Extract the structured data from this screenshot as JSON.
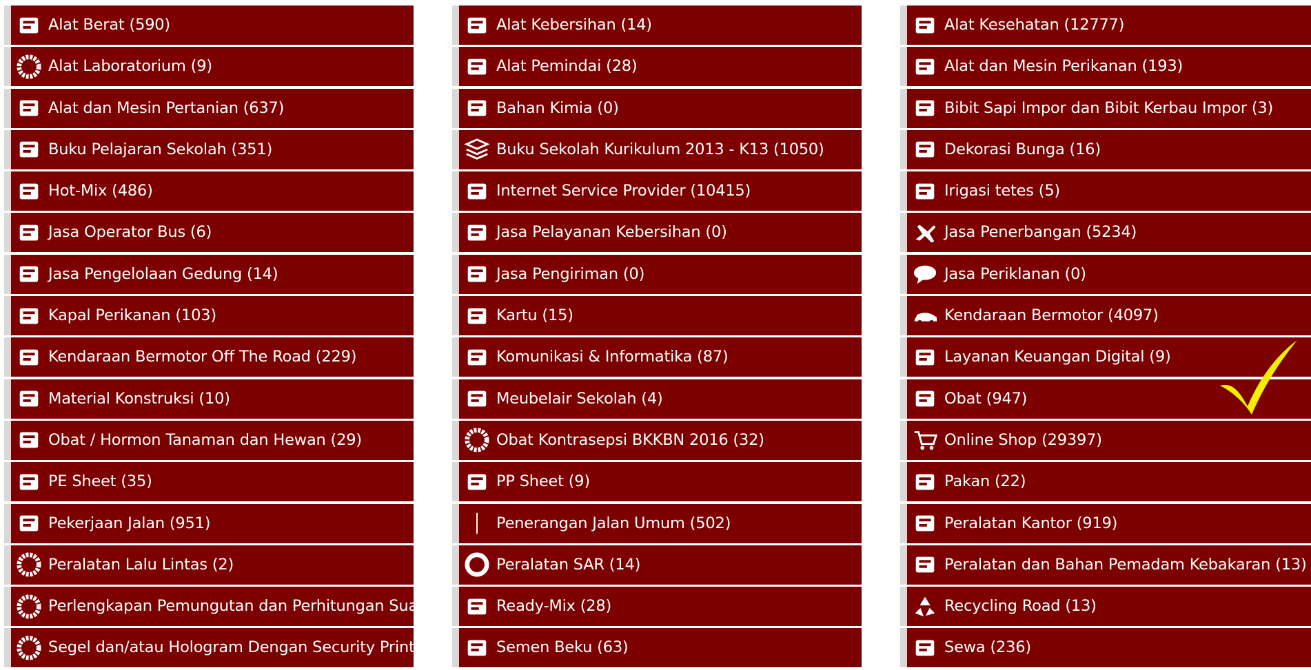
{
  "columns": [
    {
      "items": [
        {
          "label": "Alat Berat (590)",
          "icon": "excavator-icon"
        },
        {
          "label": "Alat Laboratorium (9)",
          "icon": "gear-icon"
        },
        {
          "label": "Alat dan Mesin Pertanian (637)",
          "icon": "tractor-icon"
        },
        {
          "label": "Buku Pelajaran Sekolah (351)",
          "icon": "books-icon"
        },
        {
          "label": "Hot-Mix (486)",
          "icon": "machine-icon"
        },
        {
          "label": "Jasa Operator Bus (6)",
          "icon": "bus-icon"
        },
        {
          "label": "Jasa Pengelolaan Gedung (14)",
          "icon": "building-icon"
        },
        {
          "label": "Kapal Perikanan (103)",
          "icon": "ship-icon"
        },
        {
          "label": "Kendaraan Bermotor Off The Road (229)",
          "icon": "truck-icon"
        },
        {
          "label": "Material Konstruksi (10)",
          "icon": "bricks-icon"
        },
        {
          "label": "Obat / Hormon Tanaman dan Hewan (29)",
          "icon": "medicine-icon"
        },
        {
          "label": "PE Sheet (35)",
          "icon": "sheet-icon"
        },
        {
          "label": "Pekerjaan Jalan (951)",
          "icon": "road-icon"
        },
        {
          "label": "Peralatan Lalu Lintas (2)",
          "icon": "gear-icon"
        },
        {
          "label": "Perlengkapan Pemungutan dan Perhitungan Sua",
          "icon": "gear-icon"
        },
        {
          "label": "Segel dan/atau Hologram Dengan Security Printi",
          "icon": "gear-icon"
        }
      ]
    },
    {
      "items": [
        {
          "label": "Alat Kebersihan (14)",
          "icon": "cleaning-icon"
        },
        {
          "label": "Alat Pemindai (28)",
          "icon": "scanner-icon"
        },
        {
          "label": "Bahan Kimia (0)",
          "icon": "chemical-icon"
        },
        {
          "label": "Buku Sekolah Kurikulum 2013 - K13 (1050)",
          "icon": "stack-icon"
        },
        {
          "label": "Internet Service Provider (10415)",
          "icon": "antenna-icon"
        },
        {
          "label": "Jasa Pelayanan Kebersihan (0)",
          "icon": "cleaner-person-icon"
        },
        {
          "label": "Jasa Pengiriman (0)",
          "icon": "package-icon"
        },
        {
          "label": "Kartu (15)",
          "icon": "card-icon"
        },
        {
          "label": "Komunikasi & Informatika (87)",
          "icon": "network-icon"
        },
        {
          "label": "Meubelair Sekolah (4)",
          "icon": "desk-icon"
        },
        {
          "label": "Obat Kontrasepsi BKKBN 2016 (32)",
          "icon": "gear-icon"
        },
        {
          "label": "PP Sheet (9)",
          "icon": "roll-icon"
        },
        {
          "label": "Penerangan Jalan Umum (502)",
          "icon": "streetlight-icon"
        },
        {
          "label": "Peralatan SAR (14)",
          "icon": "lifebuoy-icon"
        },
        {
          "label": "Ready-Mix (28)",
          "icon": "mixer-icon"
        },
        {
          "label": "Semen Beku (63)",
          "icon": "sperm-icon"
        }
      ]
    },
    {
      "items": [
        {
          "label": "Alat Kesehatan (12777)",
          "icon": "stethoscope-icon"
        },
        {
          "label": "Alat dan Mesin Perikanan (193)",
          "icon": "fishing-machine-icon"
        },
        {
          "label": "Bibit Sapi Impor dan Bibit Kerbau Impor (3)",
          "icon": "cow-icon"
        },
        {
          "label": "Dekorasi Bunga (16)",
          "icon": "flower-icon"
        },
        {
          "label": "Irigasi tetes (5)",
          "icon": "drip-icon"
        },
        {
          "label": "Jasa Penerbangan (5234)",
          "icon": "plane-icon"
        },
        {
          "label": "Jasa Periklanan (0)",
          "icon": "speech-bubble-icon"
        },
        {
          "label": "Kendaraan Bermotor (4097)",
          "icon": "car-icon"
        },
        {
          "label": "Layanan Keuangan Digital (9)",
          "icon": "digital-finance-icon"
        },
        {
          "label": "Obat (947)",
          "icon": "pill-icon"
        },
        {
          "label": "Online Shop (29397)",
          "icon": "cart-icon"
        },
        {
          "label": "Pakan (22)",
          "icon": "feed-icon"
        },
        {
          "label": "Peralatan Kantor (919)",
          "icon": "office-tool-icon"
        },
        {
          "label": "Peralatan dan Bahan Pemadam Kebakaran (13)",
          "icon": "extinguisher-icon"
        },
        {
          "label": "Recycling Road (13)",
          "icon": "recycle-icon"
        },
        {
          "label": "Sewa (236)",
          "icon": "rent-icon"
        }
      ]
    }
  ],
  "theme": {
    "row_bg": "#7c0000",
    "text": "#ffffff",
    "accent_border": "#d9d9d9",
    "checkmark": "#f5ee00"
  },
  "annotation": {
    "icon": "checkmark-icon"
  }
}
